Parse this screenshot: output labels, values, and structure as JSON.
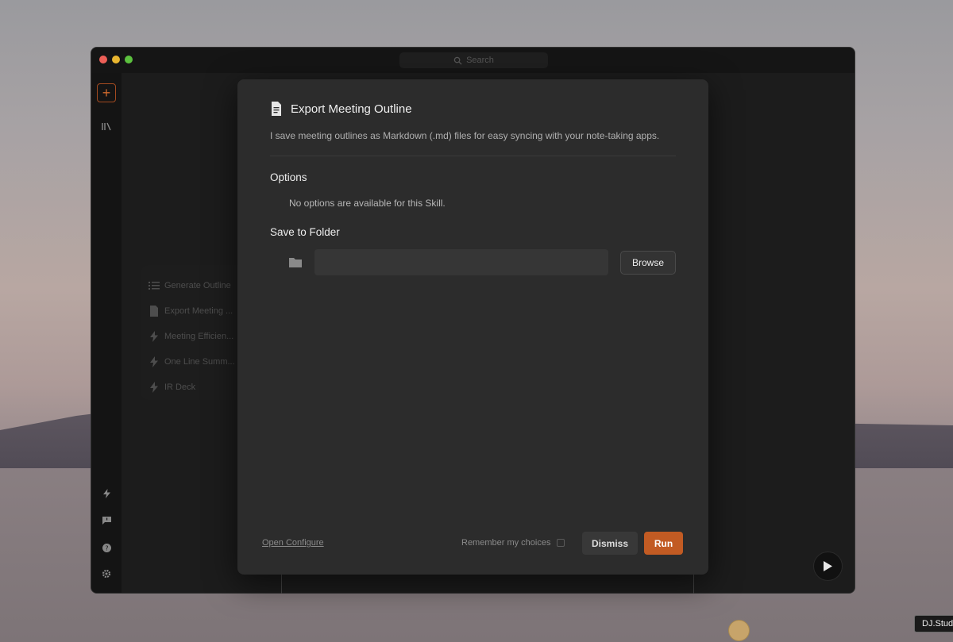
{
  "titlebar": {
    "search_placeholder": "Search"
  },
  "sidebar": {
    "icons": [
      "plus-icon",
      "library-icon",
      "bolt-icon",
      "chat-icon",
      "help-icon",
      "gear-icon"
    ]
  },
  "skills": [
    {
      "label": "Generate Outline",
      "icon": "list-icon"
    },
    {
      "label": "Export Meeting ...",
      "icon": "document-icon"
    },
    {
      "label": "Meeting Efficien...",
      "icon": "bolt-icon"
    },
    {
      "label": "One Line Summ...",
      "icon": "bolt-icon"
    },
    {
      "label": "IR Deck",
      "icon": "bolt-icon"
    }
  ],
  "dialog": {
    "title": "Export Meeting Outline",
    "description": "I save meeting outlines as Markdown (.md) files for easy syncing with your note-taking apps.",
    "options_title": "Options",
    "options_empty": "No options are available for this Skill.",
    "save_title": "Save to Folder",
    "folder_value": "",
    "browse_label": "Browse",
    "open_configure": "Open Configure",
    "remember_label": "Remember my choices",
    "remember_checked": false,
    "dismiss_label": "Dismiss",
    "run_label": "Run"
  },
  "desktop": {
    "corner_label": "DJ.Stud"
  },
  "colors": {
    "accent": "#c25b23",
    "dialog_bg": "#2c2c2c"
  }
}
